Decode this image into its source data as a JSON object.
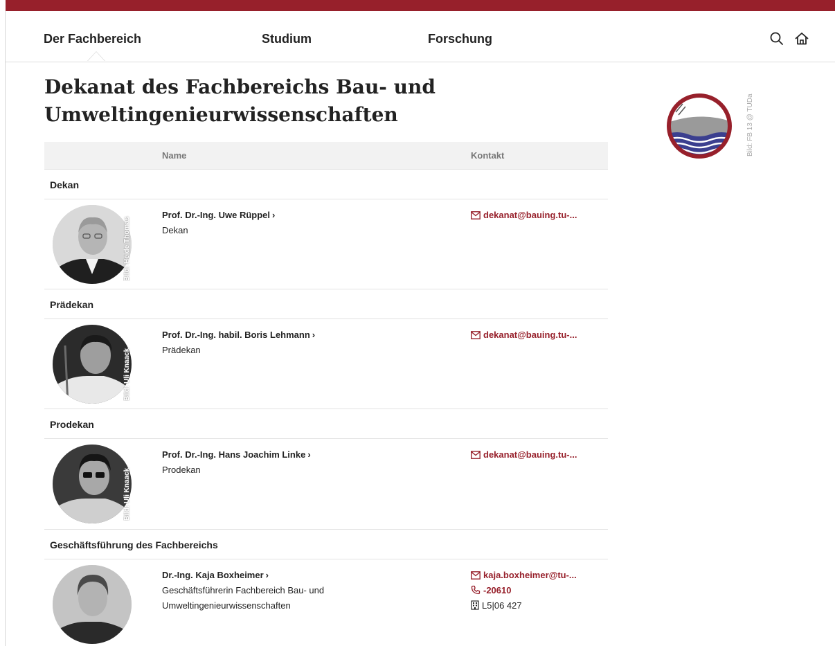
{
  "colors": {
    "accent": "#97202b",
    "text": "#222222",
    "header_bg": "#f2f2f2"
  },
  "nav": {
    "items": [
      {
        "label": "Der Fachbereich",
        "active": true
      },
      {
        "label": "Studium"
      },
      {
        "label": "Forschung"
      }
    ],
    "icons": [
      "search-icon",
      "home-icon"
    ]
  },
  "page": {
    "title_line1": "Dekanat des Fachbereichs Bau- und",
    "title_line2": "Umweltingenieurwissenschaften"
  },
  "logo": {
    "credit": "Bild: FB 13 @ TUDa"
  },
  "table": {
    "headers": {
      "name": "Name",
      "contact": "Kontakt"
    },
    "groups": [
      {
        "label": "Dekan",
        "person": {
          "name": "Prof. Dr.-Ing. Uwe Rüppel",
          "role": "Dekan",
          "email": "dekanat@bauing.tu-...",
          "photo_credit": "Bild: Heide Thomas"
        }
      },
      {
        "label": "Prädekan",
        "person": {
          "name": "Prof. Dr.-Ing. habil. Boris Lehmann",
          "role": "Prädekan",
          "email": "dekanat@bauing.tu-...",
          "photo_credit": "Bild: Uli Knaack"
        }
      },
      {
        "label": "Prodekan",
        "person": {
          "name": "Prof. Dr.-Ing. Hans Joachim Linke",
          "role": "Prodekan",
          "email": "dekanat@bauing.tu-...",
          "photo_credit": "Bild: Uli Knaack"
        }
      },
      {
        "label": "Geschäftsführung des Fachbereichs",
        "person": {
          "name": "Dr.-Ing. Kaja Boxheimer",
          "role_line1": "Geschäftsführerin Fachbereich Bau- und",
          "role_line2": "Umweltingenieurwissenschaften",
          "email": "kaja.boxheimer@tu-...",
          "phone": "-20610",
          "room": "L5|06 427"
        }
      }
    ]
  }
}
